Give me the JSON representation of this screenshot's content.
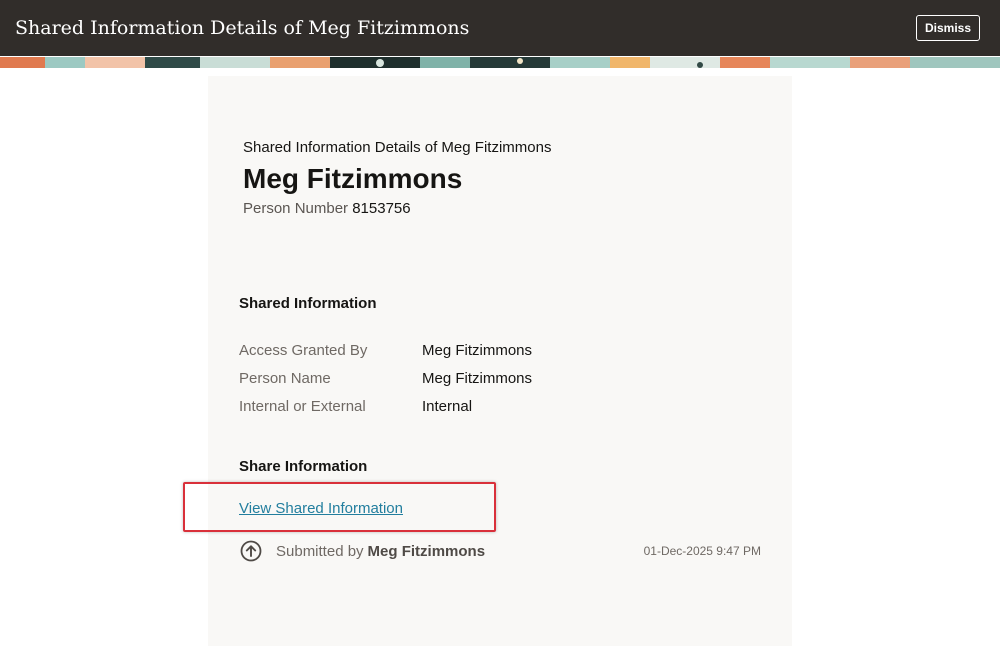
{
  "header": {
    "title": "Shared Information Details of Meg Fitzimmons",
    "dismiss_label": "Dismiss"
  },
  "card": {
    "subtitle": "Shared Information Details of Meg Fitzimmons",
    "person_name": "Meg Fitzimmons",
    "person_number_label": "Person Number",
    "person_number": "8153756"
  },
  "shared_information": {
    "heading": "Shared Information",
    "rows": [
      {
        "label": "Access Granted By",
        "value": "Meg Fitzimmons"
      },
      {
        "label": "Person Name",
        "value": "Meg Fitzimmons"
      },
      {
        "label": "Internal or External",
        "value": "Internal"
      }
    ]
  },
  "share_information": {
    "heading": "Share Information",
    "link_label": "View Shared Information"
  },
  "submission": {
    "icon": "upload-arrow-circle-icon",
    "prefix": "Submitted by",
    "by": "Meg Fitzimmons",
    "timestamp": "01-Dec-2025 9:47 PM"
  },
  "colors": {
    "header_bg": "#312d2a",
    "link": "#227e9e",
    "highlight_border": "#d9303a",
    "card_bg": "#f9f8f6"
  }
}
